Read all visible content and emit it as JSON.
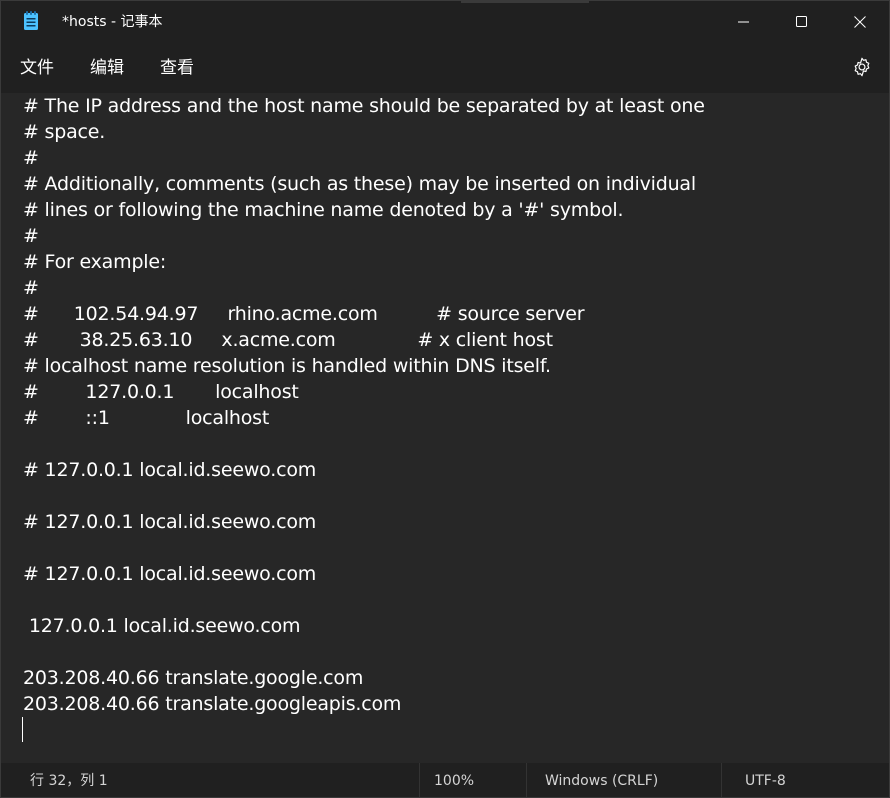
{
  "window": {
    "title": "*hosts - 记事本",
    "app_icon": "notepad-icon",
    "controls": [
      "minimize-icon",
      "maximize-icon",
      "close-icon"
    ]
  },
  "menu": {
    "file": "文件",
    "edit": "编辑",
    "view": "查看",
    "settings_icon": "gear-icon"
  },
  "editor": {
    "lines": [
      "# The IP address and the host name should be separated by at least one",
      "# space.",
      "#",
      "# Additionally, comments (such as these) may be inserted on individual",
      "# lines or following the machine name denoted by a '#' symbol.",
      "#",
      "# For example:",
      "#",
      "#      102.54.94.97     rhino.acme.com          # source server",
      "#       38.25.63.10     x.acme.com              # x client host",
      "# localhost name resolution is handled within DNS itself.",
      "#        127.0.0.1       localhost",
      "#        ::1             localhost",
      "",
      "# 127.0.0.1 local.id.seewo.com",
      "",
      "# 127.0.0.1 local.id.seewo.com",
      "",
      "# 127.0.0.1 local.id.seewo.com",
      "",
      " 127.0.0.1 local.id.seewo.com",
      "",
      "203.208.40.66 translate.google.com",
      "203.208.40.66 translate.googleapis.com",
      ""
    ]
  },
  "status": {
    "position": "行 32，列 1",
    "zoom": "100%",
    "line_ending": "Windows (CRLF)",
    "encoding": "UTF-8"
  },
  "colors": {
    "background": "#272727",
    "chrome": "#202020",
    "text": "#ffffff",
    "status_text": "#d4d4d4",
    "icon_accent": "#4cc2ff"
  }
}
